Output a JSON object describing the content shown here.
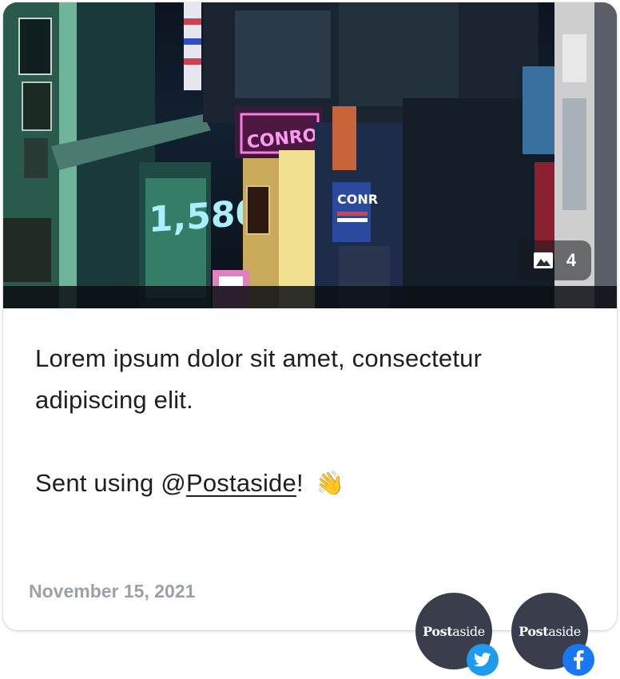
{
  "post": {
    "image": {
      "photo_count": "4"
    },
    "text_line1": "Lorem ipsum dolor sit amet, consectetur adipiscing elit.",
    "text_line2_prefix": "Sent using @",
    "mention": "Postaside",
    "text_line2_suffix": "!",
    "emoji": "👋",
    "date": "November 15, 2021"
  },
  "accounts": [
    {
      "brand_bold": "Post",
      "brand_rest": "aside",
      "network": "twitter-icon"
    },
    {
      "brand_bold": "Post",
      "brand_rest": "aside",
      "network": "facebook-icon"
    }
  ],
  "colors": {
    "avatar_bg": "#3a3d4b",
    "twitter": "#1d9bf0",
    "facebook": "#1877f2",
    "date_text": "#9aa1ab"
  },
  "image_sign_text": {
    "neon_sign": "CONROWN",
    "storefront_number": "1,580",
    "shop_sign": "CONR"
  }
}
